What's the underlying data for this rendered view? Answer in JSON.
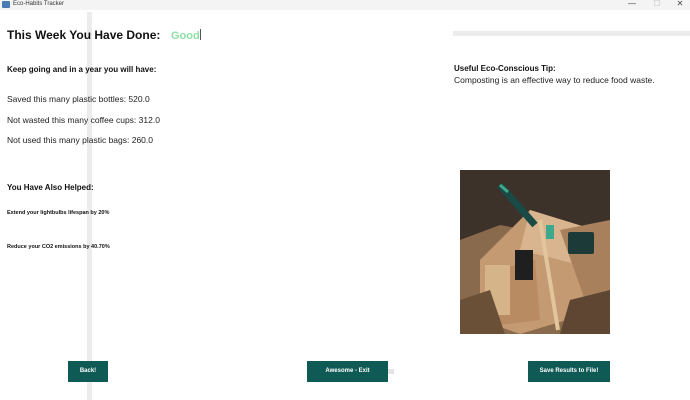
{
  "window": {
    "title": "Eco-Habits Tracker",
    "controls": {
      "minimize": "—",
      "maximize": "☐",
      "close": "✕"
    }
  },
  "main": {
    "heading": "This Week You Have Done:",
    "status": "Good",
    "sub_heading": "Keep going and in a year you will have:",
    "stats": [
      "Saved this many plastic bottles: 520.0",
      "Not wasted this many coffee cups: 312.0",
      "Not used this many plastic bags: 260.0"
    ],
    "helped_heading": "You Have Also Helped:",
    "helped": [
      "Extend your lightbulbs lifespan by 20%",
      "Reduce your CO2 emissions by 40.70%"
    ]
  },
  "tip": {
    "title": "Useful Eco-Conscious Tip:",
    "text": "Composting is an effective way to reduce food waste."
  },
  "buttons": {
    "back": "Back!",
    "exit": "Awesome - Exit",
    "save": "Save Results to File!"
  },
  "colors": {
    "button": "#0f5a55",
    "status": "#8fe0a6"
  }
}
